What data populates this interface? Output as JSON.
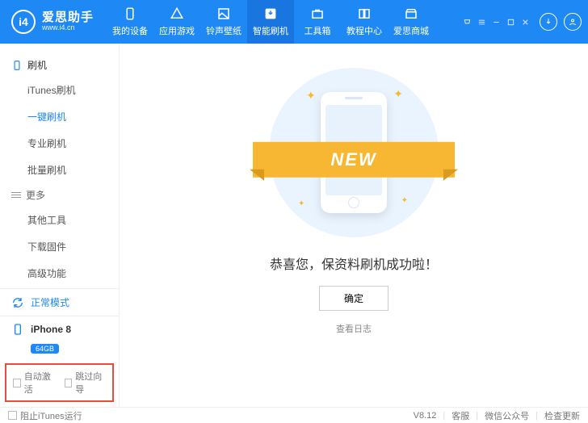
{
  "brand": {
    "name": "爱思助手",
    "url": "www.i4.cn",
    "logo_text": "i4"
  },
  "nav": [
    {
      "label": "我的设备"
    },
    {
      "label": "应用游戏"
    },
    {
      "label": "铃声壁纸"
    },
    {
      "label": "智能刷机",
      "active": true
    },
    {
      "label": "工具箱"
    },
    {
      "label": "教程中心"
    },
    {
      "label": "爱思商城"
    }
  ],
  "sidebar": {
    "flash_title": "刷机",
    "flash_items": [
      {
        "label": "iTunes刷机"
      },
      {
        "label": "一键刷机",
        "active": true
      },
      {
        "label": "专业刷机"
      },
      {
        "label": "批量刷机"
      }
    ],
    "more_title": "更多",
    "more_items": [
      {
        "label": "其他工具"
      },
      {
        "label": "下载固件"
      },
      {
        "label": "高级功能"
      }
    ],
    "mode": "正常模式",
    "device_name": "iPhone 8",
    "device_badge": "64GB",
    "options": {
      "auto_activate": "自动激活",
      "skip_guide": "跳过向导"
    }
  },
  "main": {
    "ribbon": "NEW",
    "message": "恭喜您，保资料刷机成功啦！",
    "ok": "确定",
    "view_log": "查看日志"
  },
  "footer": {
    "block_itunes": "阻止iTunes运行",
    "version": "V8.12",
    "support": "客服",
    "wechat": "微信公众号",
    "update": "检查更新"
  }
}
